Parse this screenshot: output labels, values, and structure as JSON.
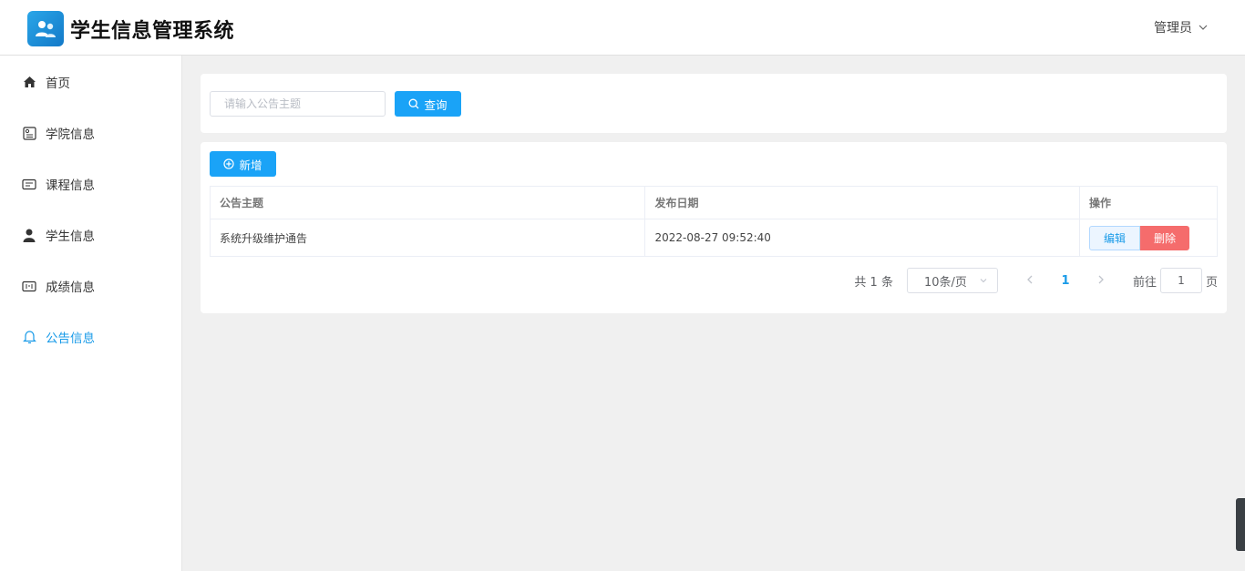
{
  "header": {
    "app_title": "学生信息管理系统",
    "user_label": "管理员"
  },
  "sidebar": {
    "items": [
      {
        "label": "首页",
        "icon": "home-icon"
      },
      {
        "label": "学院信息",
        "icon": "college-icon"
      },
      {
        "label": "课程信息",
        "icon": "course-icon"
      },
      {
        "label": "学生信息",
        "icon": "user-icon"
      },
      {
        "label": "成绩信息",
        "icon": "score-icon"
      },
      {
        "label": "公告信息",
        "icon": "bell-icon",
        "active": true
      }
    ]
  },
  "search": {
    "placeholder": "请输入公告主题",
    "query_label": "查询"
  },
  "toolbar": {
    "add_label": "新增"
  },
  "table": {
    "headers": [
      "公告主题",
      "发布日期",
      "操作"
    ],
    "rows": [
      {
        "topic": "系统升级维护通告",
        "date": "2022-08-27 09:52:40",
        "edit_label": "编辑",
        "delete_label": "删除"
      }
    ]
  },
  "pagination": {
    "total_text": "共 1 条",
    "page_size": "10条/页",
    "current_page": "1",
    "goto_prefix": "前往",
    "goto_value": "1",
    "goto_suffix": "页"
  },
  "colors": {
    "accent": "#1aa3f7",
    "danger": "#f56c6c",
    "background": "#f0f0f0"
  }
}
